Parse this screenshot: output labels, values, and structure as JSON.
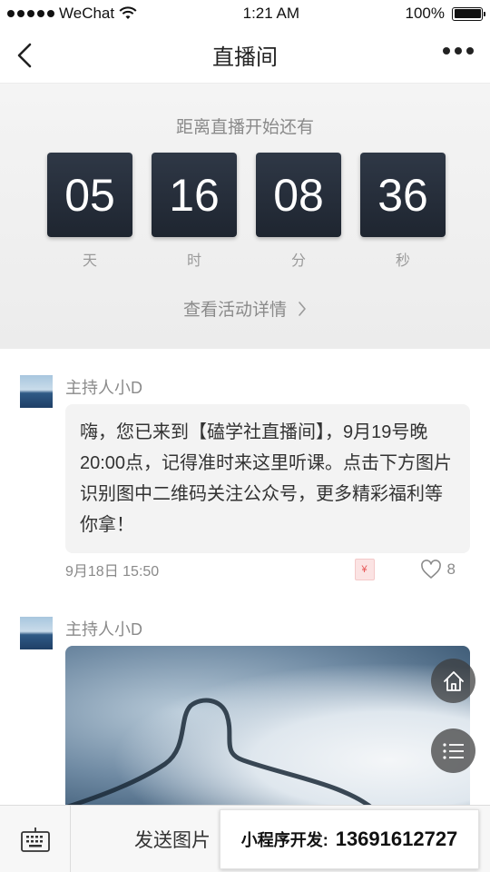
{
  "status_bar": {
    "carrier": "WeChat",
    "time": "1:21 AM",
    "battery": "100%",
    "battery_level": 1.0
  },
  "nav": {
    "title": "直播间"
  },
  "countdown": {
    "label": "距离直播开始还有",
    "units": [
      {
        "value": "05",
        "caption": "天"
      },
      {
        "value": "16",
        "caption": "时"
      },
      {
        "value": "08",
        "caption": "分"
      },
      {
        "value": "36",
        "caption": "秒"
      }
    ],
    "details_link": "查看活动详情"
  },
  "messages": [
    {
      "sender": "主持人小D",
      "text": "嗨，您已来到【磕学社直播间】，9月19号晚20:00点，记得准时来这里听课。点击下方图片识别图中二维码关注公众号，更多精彩福利等你拿！",
      "time": "9月18日 15:50",
      "redpack_label": "¥",
      "likes": "8"
    },
    {
      "sender": "主持人小D"
    }
  ],
  "bottom_bar": {
    "send_image_label": "发送图片"
  },
  "promo": {
    "label": "小程序开发:",
    "number": "13691612727"
  },
  "icons": [
    "back-icon",
    "more-icon",
    "chevron-right-icon",
    "redpack-icon",
    "heart-icon",
    "home-icon",
    "list-icon",
    "keyboard-icon"
  ]
}
